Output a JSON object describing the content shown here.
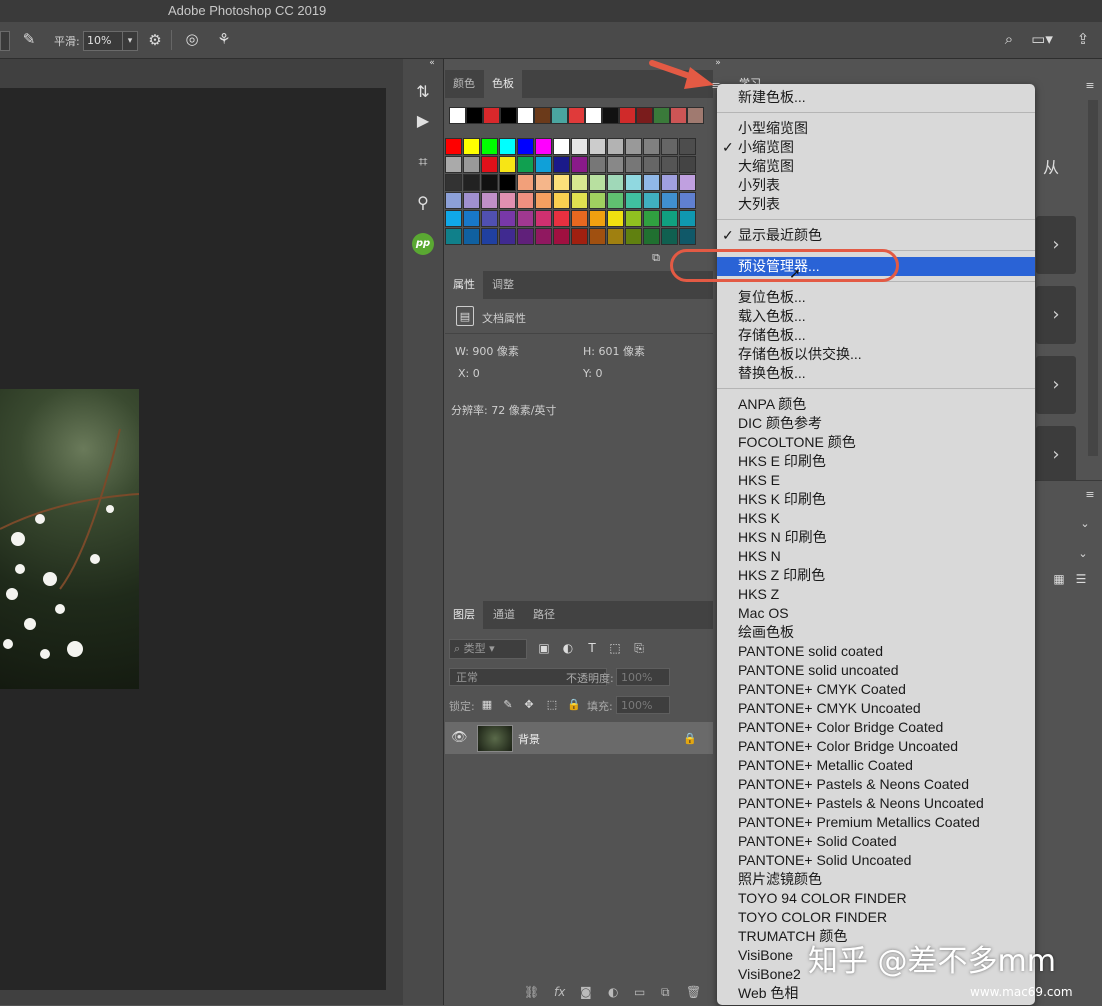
{
  "app_title": "Adobe Photoshop CC 2019",
  "options_bar": {
    "smooth_label": "平滑:",
    "smooth_value": "10%"
  },
  "swatch_panel": {
    "tabs": [
      "颜色",
      "色板"
    ],
    "active_tab": "色板",
    "recent_colors": [
      "#ffffff",
      "#000000",
      "#d8282b",
      "#000000",
      "#ffffff",
      "#6b3a1a",
      "#4aa5a0",
      "#e03a3a",
      "#ffffff",
      "#111111",
      "#d02a2a",
      "#7a1c1c",
      "#3a7a3a",
      "#cc5555",
      "#a07a70"
    ],
    "grid_colors": [
      [
        "#ff0000",
        "#ffff00",
        "#00ff00",
        "#00ffff",
        "#0000ff",
        "#ff00ff",
        "#ffffff",
        "#e6e6e6",
        "#cccccc",
        "#b3b3b3",
        "#999999",
        "#808080",
        "#666666",
        "#4d4d4d"
      ],
      [
        "#aaaaaa",
        "#999999",
        "#e0101a",
        "#f7e515",
        "#10a050",
        "#10a0d8",
        "#1a1a8a",
        "#8a1a8a",
        "#777777",
        "#888888",
        "#777777",
        "#666666",
        "#555555",
        "#444444"
      ],
      [
        "#333333",
        "#222222",
        "#111111",
        "#000000",
        "#f2a07a",
        "#f5b68a",
        "#fde07a",
        "#d8e890",
        "#b8e0a0",
        "#a0d8b8",
        "#90d8e0",
        "#90b8e8",
        "#a0a0e0",
        "#c0a0e0"
      ],
      [
        "#8ca0d8",
        "#a090d0",
        "#c090c8",
        "#e090b0",
        "#f09080",
        "#f5a060",
        "#fad050",
        "#e0e050",
        "#a0d060",
        "#60c070",
        "#40c0a0",
        "#40b0c0",
        "#4090d0",
        "#6080d0"
      ],
      [
        "#10a8e8",
        "#1878c8",
        "#5050b0",
        "#7838a8",
        "#a03890",
        "#d03070",
        "#e83040",
        "#e86820",
        "#f0a010",
        "#f0e010",
        "#90c020",
        "#30a040",
        "#10a080",
        "#1098b0"
      ],
      [
        "#10808a",
        "#1060a0",
        "#2040a0",
        "#402a90",
        "#60207a",
        "#901860",
        "#a01040",
        "#a02010",
        "#a05010",
        "#a08010",
        "#608010",
        "#207030",
        "#106050",
        "#105868"
      ]
    ]
  },
  "properties_panel": {
    "tabs": [
      "属性",
      "调整"
    ],
    "active_tab": "属性",
    "doc_label": "文档属性",
    "width": "W: 900 像素",
    "height": "H: 601 像素",
    "x": "X: 0",
    "y": "Y: 0",
    "resolution": "分辨率: 72 像素/英寸"
  },
  "layers_panel": {
    "tabs": [
      "图层",
      "通道",
      "路径"
    ],
    "active_tab": "图层",
    "filter_label": "类型",
    "blend_mode": "正常",
    "opacity_label": "不透明度:",
    "opacity_value": "100%",
    "lock_label": "锁定:",
    "fill_label": "填充:",
    "fill_value": "100%",
    "layer_name": "背景"
  },
  "learn_panel": {
    "tab": "学习",
    "char": "从"
  },
  "menu": {
    "groups": [
      [
        {
          "label": "新建色板...",
          "checked": false
        }
      ],
      [
        {
          "label": "小型缩览图",
          "checked": false
        },
        {
          "label": "小缩览图",
          "checked": true
        },
        {
          "label": "大缩览图",
          "checked": false
        },
        {
          "label": "小列表",
          "checked": false
        },
        {
          "label": "大列表",
          "checked": false
        }
      ],
      [
        {
          "label": "显示最近颜色",
          "checked": true
        }
      ],
      [
        {
          "label": "预设管理器...",
          "checked": false,
          "highlighted": true
        }
      ],
      [
        {
          "label": "复位色板...",
          "checked": false
        },
        {
          "label": "载入色板...",
          "checked": false
        },
        {
          "label": "存储色板...",
          "checked": false
        },
        {
          "label": "存储色板以供交换...",
          "checked": false
        },
        {
          "label": "替换色板...",
          "checked": false
        }
      ],
      [
        {
          "label": "ANPA 颜色"
        },
        {
          "label": "DIC 颜色参考"
        },
        {
          "label": "FOCOLTONE 颜色"
        },
        {
          "label": "HKS E 印刷色"
        },
        {
          "label": "HKS E"
        },
        {
          "label": "HKS K 印刷色"
        },
        {
          "label": "HKS K"
        },
        {
          "label": "HKS N 印刷色"
        },
        {
          "label": "HKS N"
        },
        {
          "label": "HKS Z 印刷色"
        },
        {
          "label": "HKS Z"
        },
        {
          "label": "Mac OS"
        },
        {
          "label": "绘画色板"
        },
        {
          "label": "PANTONE solid coated"
        },
        {
          "label": "PANTONE solid uncoated"
        },
        {
          "label": "PANTONE+ CMYK Coated"
        },
        {
          "label": "PANTONE+ CMYK Uncoated"
        },
        {
          "label": "PANTONE+ Color Bridge Coated"
        },
        {
          "label": "PANTONE+ Color Bridge Uncoated"
        },
        {
          "label": "PANTONE+ Metallic Coated"
        },
        {
          "label": "PANTONE+ Pastels & Neons Coated"
        },
        {
          "label": "PANTONE+ Pastels & Neons Uncoated"
        },
        {
          "label": "PANTONE+ Premium Metallics Coated"
        },
        {
          "label": "PANTONE+ Solid Coated"
        },
        {
          "label": "PANTONE+ Solid Uncoated"
        },
        {
          "label": "照片滤镜颜色"
        },
        {
          "label": "TOYO 94 COLOR FINDER"
        },
        {
          "label": "TOYO COLOR FINDER"
        },
        {
          "label": "TRUMATCH 颜色"
        },
        {
          "label": "VisiBone"
        },
        {
          "label": "VisiBone2"
        },
        {
          "label": "Web 色相"
        }
      ]
    ]
  },
  "watermark": {
    "text": "知乎 @差不多mm",
    "site": "www.mac69.com"
  },
  "colors": {
    "menu_bg": "#d9d9d9",
    "highlight": "#2a63d6",
    "annotation": "#e35a44"
  }
}
